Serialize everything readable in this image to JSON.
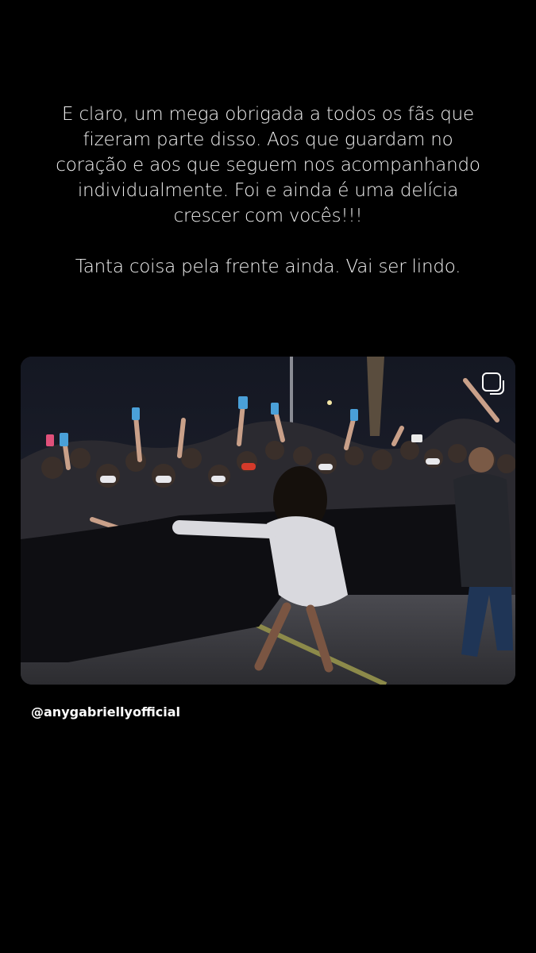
{
  "story": {
    "paragraph1_lines": [
      "E claro, um mega obrigada a todos os fãs que",
      "fizeram parte disso. Aos que guardam no",
      "coração e aos que seguem nos acompanhando",
      "individualmente. Foi e ainda é uma delícia",
      "crescer com vocês!!!"
    ],
    "paragraph2": "Tanta coisa pela frente ainda. Vai ser lindo."
  },
  "post": {
    "mention": "@anygabriellyofficial",
    "icon": "shared-post-icon"
  },
  "colors": {
    "background": "#000000",
    "text": "#f2f2f2",
    "barrier": "#0e0e12",
    "hoodie": "#d9d9de"
  }
}
